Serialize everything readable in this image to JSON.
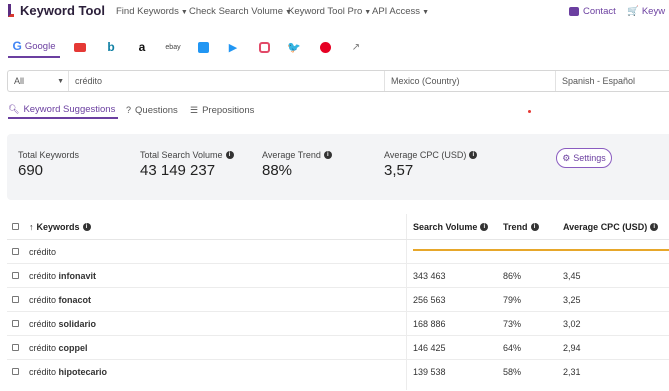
{
  "app": {
    "title": "Keyword Tool"
  },
  "nav": {
    "items": [
      {
        "label": "Find Keywords"
      },
      {
        "label": "Check Search Volume"
      },
      {
        "label": "Keyword Tool Pro"
      },
      {
        "label": "API Access"
      }
    ],
    "contact": "Contact",
    "keyword_cut": "Keyw"
  },
  "engines": [
    {
      "name": "google-icon",
      "label": "Google",
      "active": true
    },
    {
      "name": "youtube-icon",
      "color": "#e53935"
    },
    {
      "name": "bing-icon",
      "color": "#0f7fa3"
    },
    {
      "name": "amazon-icon",
      "color": "#111111"
    },
    {
      "name": "ebay-icon",
      "label": "ebay"
    },
    {
      "name": "appstore-icon",
      "color": "#2196f3"
    },
    {
      "name": "playstore-icon",
      "color": "#2196f3"
    },
    {
      "name": "instagram-icon",
      "color": "#e24a68"
    },
    {
      "name": "twitter-icon",
      "color": "#1da1f2"
    },
    {
      "name": "pinterest-icon",
      "color": "#e60023"
    },
    {
      "name": "trends-icon",
      "color": "#777777"
    }
  ],
  "search": {
    "mode": "All",
    "query": "crédito",
    "location": "Mexico (Country)",
    "language": "Spanish - Español"
  },
  "subtabs": [
    {
      "label": "Keyword Suggestions",
      "icon": "search-icon",
      "active": true
    },
    {
      "label": "Questions",
      "icon": "question-icon"
    },
    {
      "label": "Prepositions",
      "icon": "list-icon"
    }
  ],
  "stats": {
    "total_keywords": {
      "label": "Total Keywords",
      "value": "690"
    },
    "total_volume": {
      "label": "Total Search Volume",
      "value": "43 149 237"
    },
    "avg_trend": {
      "label": "Average Trend",
      "value": "88%"
    },
    "avg_cpc": {
      "label": "Average CPC (USD)",
      "value": "3,57"
    },
    "settings_label": "Settings"
  },
  "table": {
    "headers": {
      "keywords": "Keywords",
      "volume": "Search Volume",
      "trend": "Trend",
      "cpc": "Average CPC (USD)"
    },
    "seed_row": {
      "keyword": "crédito"
    },
    "rows": [
      {
        "base": "crédito",
        "suffix": "infonavit",
        "volume": "343 463",
        "trend": "86%",
        "cpc": "3,45"
      },
      {
        "base": "crédito",
        "suffix": "fonacot",
        "volume": "256 563",
        "trend": "79%",
        "cpc": "3,25"
      },
      {
        "base": "crédito",
        "suffix": "solidario",
        "volume": "168 886",
        "trend": "73%",
        "cpc": "3,02"
      },
      {
        "base": "crédito",
        "suffix": "coppel",
        "volume": "146 425",
        "trend": "64%",
        "cpc": "2,94"
      },
      {
        "base": "crédito",
        "suffix": "hipotecario",
        "volume": "139 538",
        "trend": "58%",
        "cpc": "2,31"
      }
    ]
  },
  "colors": {
    "accent": "#6b3fa0",
    "loading": "#e7a72a"
  }
}
